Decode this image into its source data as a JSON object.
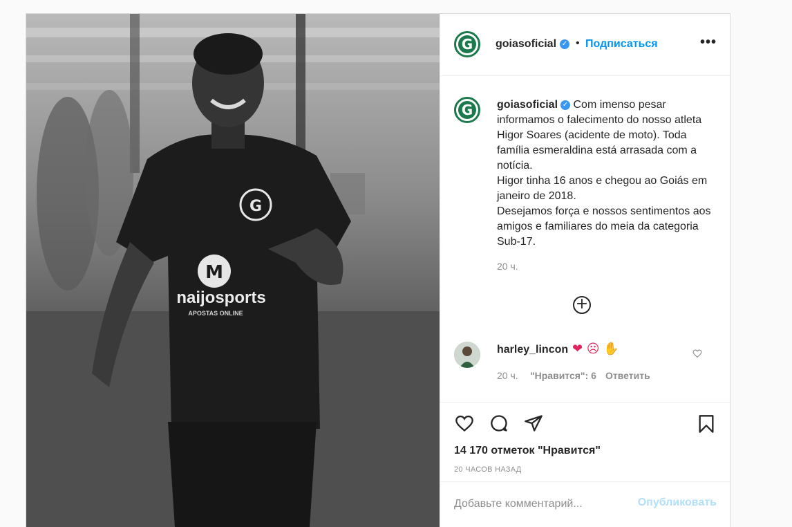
{
  "header": {
    "username": "goiasoficial",
    "separator": "•",
    "follow_label": "Подписаться",
    "more_label": "•••",
    "logo_letter": "G"
  },
  "caption": {
    "username": "goiasoficial",
    "text": "Com imenso pesar informamos o falecimento do nosso atleta Higor Soares (acidente de moto). Toda família esmeraldina está arrasada com a notícia.\nHigor tinha 16 anos e chegou ao Goiás em janeiro de 2018.\nDesejamos força e nossos sentimentos aos amigos e familiares do meia da categoria Sub-17.",
    "time": "20 ч."
  },
  "comment": {
    "username": "harley_lincon",
    "emojis": "❤ ☹ ✋",
    "time": "20 ч.",
    "likes": "\"Нравится\": 6",
    "reply_label": "Ответить"
  },
  "photo": {
    "sponsor_text": "naijosports",
    "sponsor_sub": "APOSTAS ONLINE"
  },
  "stats": {
    "likes": "14 170 отметок \"Нравится\"",
    "posted": "20 ЧАСОВ НАЗАД"
  },
  "composer": {
    "placeholder": "Добавьте комментарий...",
    "publish_label": "Опубликовать"
  },
  "colors": {
    "accent": "#0095f6",
    "brand_green": "#1a7a4c",
    "publish_disabled": "#b2dffc"
  }
}
